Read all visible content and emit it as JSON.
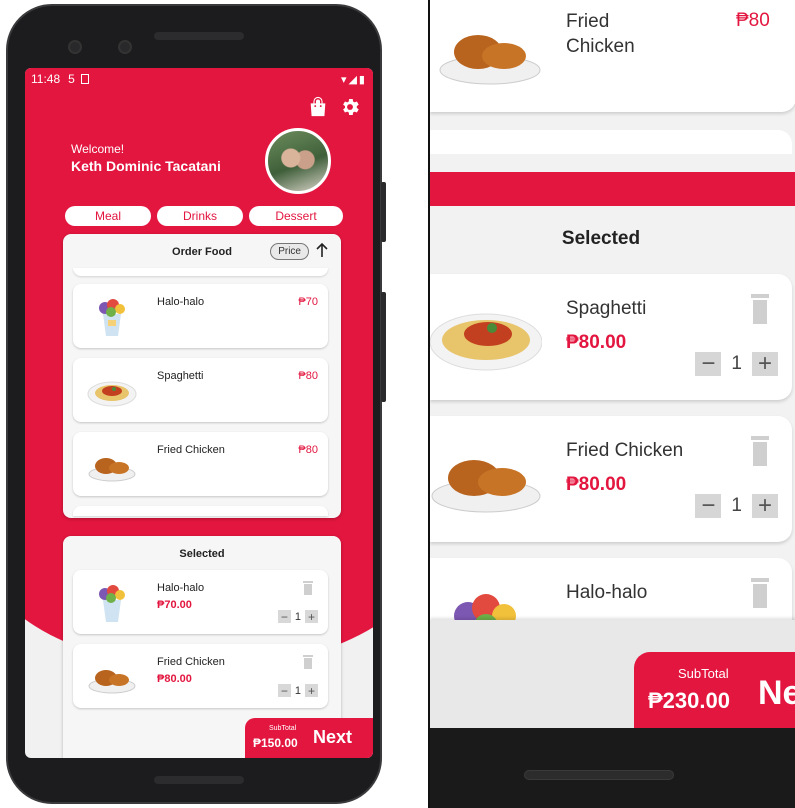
{
  "status_bar": {
    "time": "11:48",
    "indicator": "5"
  },
  "header": {
    "welcome": "Welcome!",
    "user_name": "Keth Dominic Tacatani"
  },
  "categories": [
    "Meal",
    "Drinks",
    "Dessert"
  ],
  "order": {
    "title": "Order Food",
    "sort_label": "Price",
    "items": [
      {
        "name": "Halo-halo",
        "price": "₱70"
      },
      {
        "name": "Spaghetti",
        "price": "₱80"
      },
      {
        "name": "Fried Chicken",
        "price": "₱80"
      }
    ]
  },
  "selected": {
    "title": "Selected",
    "items": [
      {
        "name": "Halo-halo",
        "price": "₱70.00",
        "qty": "1"
      },
      {
        "name": "Fried Chicken",
        "price": "₱80.00",
        "qty": "1"
      }
    ]
  },
  "footer": {
    "subtotal_label": "SubTotal",
    "subtotal": "₱150.00",
    "next_label": "Next"
  },
  "zoom": {
    "top_item": {
      "name": "Fried Chicken",
      "price": "₱80"
    },
    "selected_title": "Selected",
    "items": [
      {
        "name": "Spaghetti",
        "price": "₱80.00",
        "qty": "1"
      },
      {
        "name": "Fried Chicken",
        "price": "₱80.00",
        "qty": "1"
      },
      {
        "name": "Halo-halo"
      }
    ],
    "subtotal_label": "SubTotal",
    "subtotal": "₱230.00",
    "next_label": "Ne"
  },
  "colors": {
    "accent": "#e3163f",
    "panel": "#f6f6f6"
  }
}
